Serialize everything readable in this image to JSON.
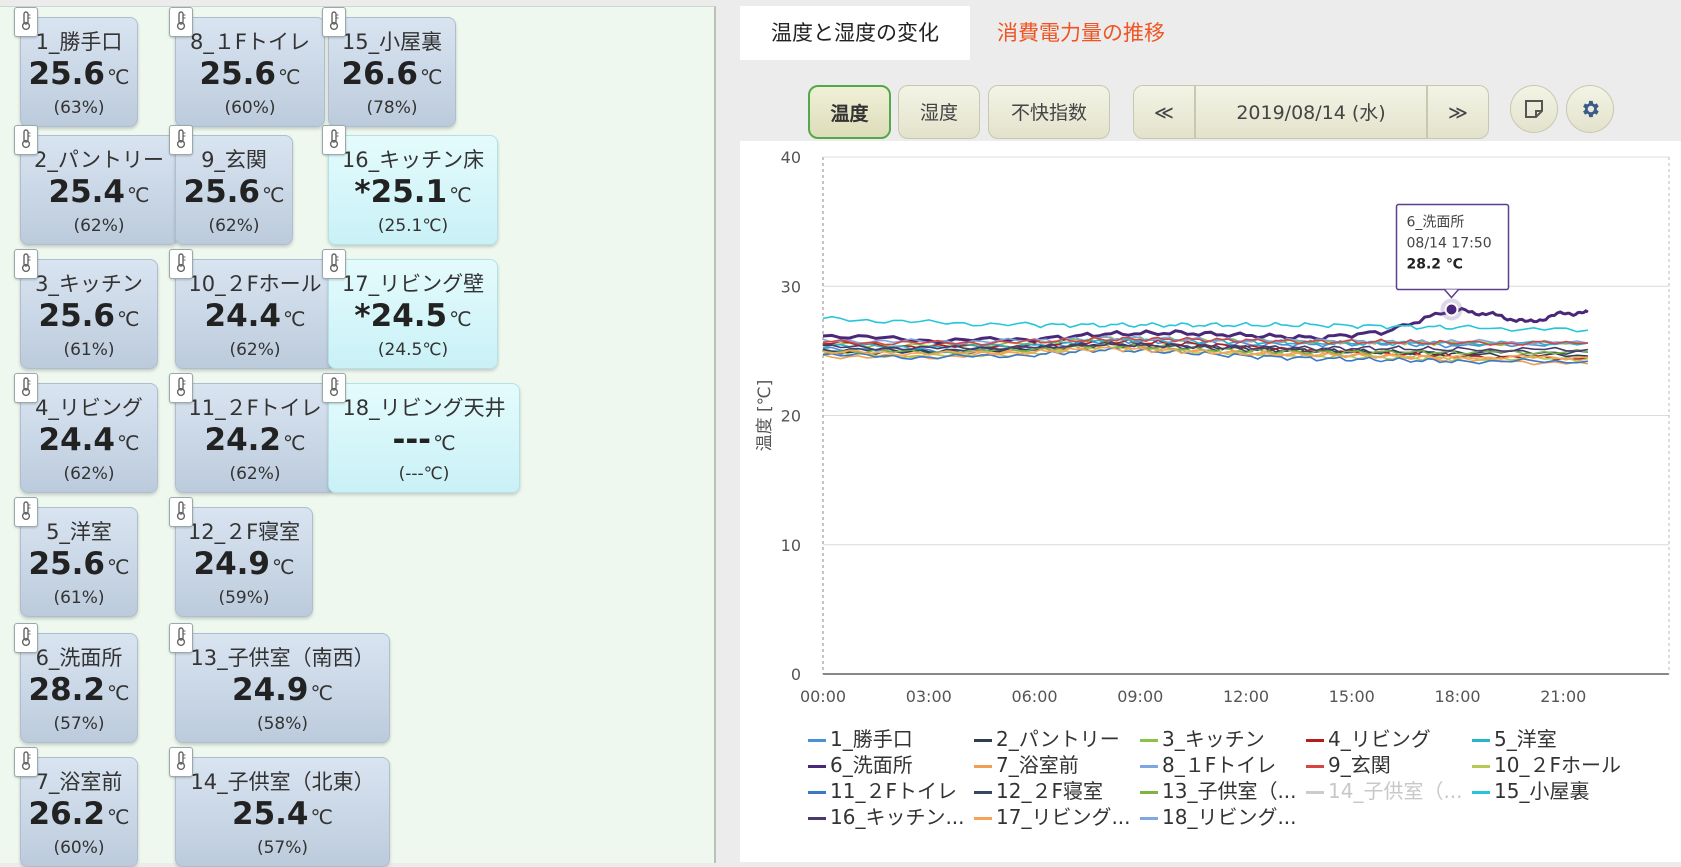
{
  "sensors": [
    {
      "id": "s1",
      "name": "1_勝手口",
      "value": "25.6",
      "unit": "℃",
      "humidity": "(63%)",
      "cyan": false
    },
    {
      "id": "s8",
      "name": "8_１Fトイレ",
      "value": "25.6",
      "unit": "℃",
      "humidity": "(60%)",
      "cyan": false
    },
    {
      "id": "s15",
      "name": "15_小屋裏",
      "value": "26.6",
      "unit": "℃",
      "humidity": "(78%)",
      "cyan": false
    },
    {
      "id": "s2",
      "name": "2_パントリー",
      "value": "25.4",
      "unit": "℃",
      "humidity": "(62%)",
      "cyan": false
    },
    {
      "id": "s9",
      "name": "9_玄関",
      "value": "25.6",
      "unit": "℃",
      "humidity": "(62%)",
      "cyan": false
    },
    {
      "id": "s16",
      "name": "16_キッチン床",
      "value": "*25.1",
      "unit": "℃",
      "humidity": "(25.1℃)",
      "cyan": true
    },
    {
      "id": "s3",
      "name": "3_キッチン",
      "value": "25.6",
      "unit": "℃",
      "humidity": "(61%)",
      "cyan": false
    },
    {
      "id": "s10",
      "name": "10_２Fホール",
      "value": "24.4",
      "unit": "℃",
      "humidity": "(62%)",
      "cyan": false
    },
    {
      "id": "s17",
      "name": "17_リビング壁",
      "value": "*24.5",
      "unit": "℃",
      "humidity": "(24.5℃)",
      "cyan": true
    },
    {
      "id": "s4",
      "name": "4_リビング",
      "value": "24.4",
      "unit": "℃",
      "humidity": "(62%)",
      "cyan": false
    },
    {
      "id": "s11",
      "name": "11_２Fトイレ",
      "value": "24.2",
      "unit": "℃",
      "humidity": "(62%)",
      "cyan": false
    },
    {
      "id": "s18",
      "name": "18_リビング天井",
      "value": "---",
      "unit": "℃",
      "humidity": "(---℃)",
      "cyan": true
    },
    {
      "id": "s5",
      "name": "5_洋室",
      "value": "25.6",
      "unit": "℃",
      "humidity": "(61%)",
      "cyan": false
    },
    {
      "id": "s12",
      "name": "12_２F寝室",
      "value": "24.9",
      "unit": "℃",
      "humidity": "(59%)",
      "cyan": false
    },
    {
      "id": "s6",
      "name": "6_洗面所",
      "value": "28.2",
      "unit": "℃",
      "humidity": "(57%)",
      "cyan": false
    },
    {
      "id": "s13",
      "name": "13_子供室（南西）",
      "value": "24.9",
      "unit": "℃",
      "humidity": "(58%)",
      "cyan": false
    },
    {
      "id": "s7",
      "name": "7_浴室前",
      "value": "26.2",
      "unit": "℃",
      "humidity": "(60%)",
      "cyan": false
    },
    {
      "id": "s14",
      "name": "14_子供室（北東）",
      "value": "25.4",
      "unit": "℃",
      "humidity": "(57%)",
      "cyan": false
    }
  ],
  "tabs": {
    "temperature": "温度と湿度の変化",
    "power": "消費電力量の推移"
  },
  "toolbar": {
    "temp_label": "温度",
    "humidity_label": "湿度",
    "discomfort_label": "不快指数",
    "prev_label": "≪",
    "date_label": "2019/08/14 (水)",
    "next_label": "≫",
    "note_icon": "note-icon",
    "settings_icon": "gear-icon"
  },
  "chart_data": {
    "type": "line",
    "ylabel": "温度 [℃]",
    "ylim": [
      0,
      40
    ],
    "yticks": [
      "0",
      "10",
      "20",
      "30",
      "40"
    ],
    "xticks": [
      "00:00",
      "03:00",
      "06:00",
      "09:00",
      "12:00",
      "15:00",
      "18:00",
      "21:00"
    ],
    "xlim_hours": [
      0,
      24
    ],
    "grid": true,
    "tooltip": {
      "series": "6_洗面所",
      "time": "08/14 17:50",
      "value": "28.2 ℃",
      "x_hours": 17.83,
      "y": 28.2
    },
    "series": [
      {
        "name": "1_勝手口",
        "color": "#4a90d9",
        "hidden": false,
        "x": [
          0,
          3,
          6,
          8,
          10,
          12,
          14,
          16,
          18,
          21.7
        ],
        "y": [
          25.2,
          25.0,
          25.2,
          25.8,
          25.7,
          25.5,
          25.5,
          25.6,
          25.4,
          25.6
        ]
      },
      {
        "name": "2_パントリー",
        "color": "#2c3e50",
        "hidden": false,
        "x": [
          0,
          3,
          6,
          8,
          10,
          12,
          14,
          16,
          18,
          21.7
        ],
        "y": [
          24.9,
          24.9,
          25.1,
          25.6,
          25.4,
          25.2,
          25.0,
          24.9,
          24.7,
          24.6
        ]
      },
      {
        "name": "3_キッチン",
        "color": "#8bc34a",
        "hidden": false,
        "x": [
          0,
          3,
          6,
          8,
          10,
          12,
          14,
          16,
          18,
          21.7
        ],
        "y": [
          25.5,
          25.4,
          25.6,
          26.0,
          25.9,
          25.8,
          25.7,
          25.7,
          25.6,
          25.6
        ]
      },
      {
        "name": "4_リビング",
        "color": "#b71c1c",
        "hidden": false,
        "x": [
          0,
          3,
          6,
          8,
          10,
          12,
          14,
          16,
          18,
          21.7
        ],
        "y": [
          25.6,
          25.3,
          25.4,
          25.7,
          25.6,
          25.3,
          25.0,
          24.8,
          24.6,
          24.4
        ]
      },
      {
        "name": "5_洋室",
        "color": "#26b6c6",
        "hidden": false,
        "x": [
          0,
          3,
          6,
          8,
          10,
          12,
          14,
          16,
          18,
          21.7
        ],
        "y": [
          25.4,
          25.3,
          25.5,
          25.8,
          25.8,
          25.7,
          25.6,
          25.6,
          25.6,
          25.6
        ]
      },
      {
        "name": "6_洗面所",
        "color": "#4a2878",
        "hidden": false,
        "x": [
          0,
          3,
          6,
          8,
          10,
          12,
          14,
          16,
          17.83,
          19,
          20,
          21,
          21.7
        ],
        "y": [
          26.2,
          25.8,
          25.9,
          26.3,
          26.4,
          26.2,
          26.0,
          26.5,
          28.2,
          27.8,
          27.2,
          27.9,
          28.0
        ]
      },
      {
        "name": "7_浴室前",
        "color": "#f0a050",
        "hidden": false,
        "x": [
          0,
          3,
          6,
          8,
          10,
          12,
          14,
          16,
          18,
          21.7
        ],
        "y": [
          24.6,
          24.5,
          25.0,
          25.5,
          25.1,
          24.8,
          24.7,
          24.6,
          24.3,
          24.0
        ]
      },
      {
        "name": "8_１Fトイレ",
        "color": "#7ea6e0",
        "hidden": false,
        "x": [
          0,
          3,
          6,
          8,
          10,
          12,
          14,
          16,
          18,
          21.7
        ],
        "y": [
          25.8,
          25.7,
          25.8,
          26.0,
          25.9,
          25.8,
          25.8,
          25.7,
          25.7,
          25.6
        ]
      },
      {
        "name": "9_玄関",
        "color": "#d64541",
        "hidden": false,
        "x": [
          0,
          3,
          6,
          8,
          10,
          12,
          14,
          16,
          18,
          21.7
        ],
        "y": [
          25.7,
          25.6,
          25.7,
          25.9,
          25.9,
          25.8,
          25.7,
          25.7,
          25.6,
          25.6
        ]
      },
      {
        "name": "10_２Fホール",
        "color": "#b5c957",
        "hidden": false,
        "x": [
          0,
          3,
          6,
          8,
          10,
          12,
          14,
          16,
          18,
          21.7
        ],
        "y": [
          24.8,
          24.6,
          24.8,
          25.2,
          25.0,
          24.8,
          24.6,
          24.5,
          24.4,
          24.4
        ]
      },
      {
        "name": "11_２Fトイレ",
        "color": "#3a78c8",
        "hidden": false,
        "x": [
          0,
          3,
          6,
          8,
          10,
          12,
          14,
          16,
          18,
          21.7
        ],
        "y": [
          24.7,
          24.5,
          24.7,
          25.1,
          24.9,
          24.6,
          24.4,
          24.3,
          24.2,
          24.2
        ]
      },
      {
        "name": "12_２F寝室",
        "color": "#34495e",
        "hidden": false,
        "x": [
          0,
          3,
          6,
          8,
          10,
          12,
          14,
          16,
          18,
          21.7
        ],
        "y": [
          25.1,
          25.0,
          25.2,
          25.5,
          25.3,
          25.1,
          25.0,
          24.9,
          24.9,
          24.9
        ]
      },
      {
        "name": "13_子供室（...",
        "color": "#7cb342",
        "hidden": false,
        "x": [
          0,
          3,
          6,
          8,
          10,
          12,
          14,
          16,
          18,
          21.7
        ],
        "y": [
          25.0,
          24.9,
          25.1,
          25.4,
          25.2,
          25.0,
          24.9,
          24.9,
          24.9,
          24.9
        ]
      },
      {
        "name": "14_子供室（...",
        "color": "#cccccc",
        "hidden": true,
        "x": [
          0,
          21.7
        ],
        "y": [
          25.4,
          25.4
        ]
      },
      {
        "name": "15_小屋裏",
        "color": "#26c6da",
        "hidden": false,
        "x": [
          0,
          3,
          6,
          8,
          10,
          12,
          14,
          16,
          18,
          21.7
        ],
        "y": [
          27.5,
          27.2,
          27.0,
          27.0,
          27.0,
          27.0,
          27.0,
          26.9,
          26.8,
          26.6
        ]
      },
      {
        "name": "16_キッチン...",
        "color": "#4a3870",
        "hidden": false,
        "x": [
          0,
          3,
          6,
          8,
          10,
          12,
          14,
          16,
          18,
          21.7
        ],
        "y": [
          25.3,
          25.2,
          25.3,
          25.5,
          25.4,
          25.3,
          25.2,
          25.2,
          25.1,
          25.1
        ]
      },
      {
        "name": "17_リビング...",
        "color": "#f5a45a",
        "hidden": false,
        "x": [
          0,
          3,
          6,
          8,
          10,
          12,
          14,
          16,
          18,
          21.7
        ],
        "y": [
          24.9,
          24.8,
          24.9,
          25.2,
          25.0,
          24.8,
          24.7,
          24.6,
          24.5,
          24.5
        ]
      },
      {
        "name": "18_リビング...",
        "color": "#80a8e0",
        "hidden": false,
        "x": [],
        "y": []
      }
    ]
  }
}
